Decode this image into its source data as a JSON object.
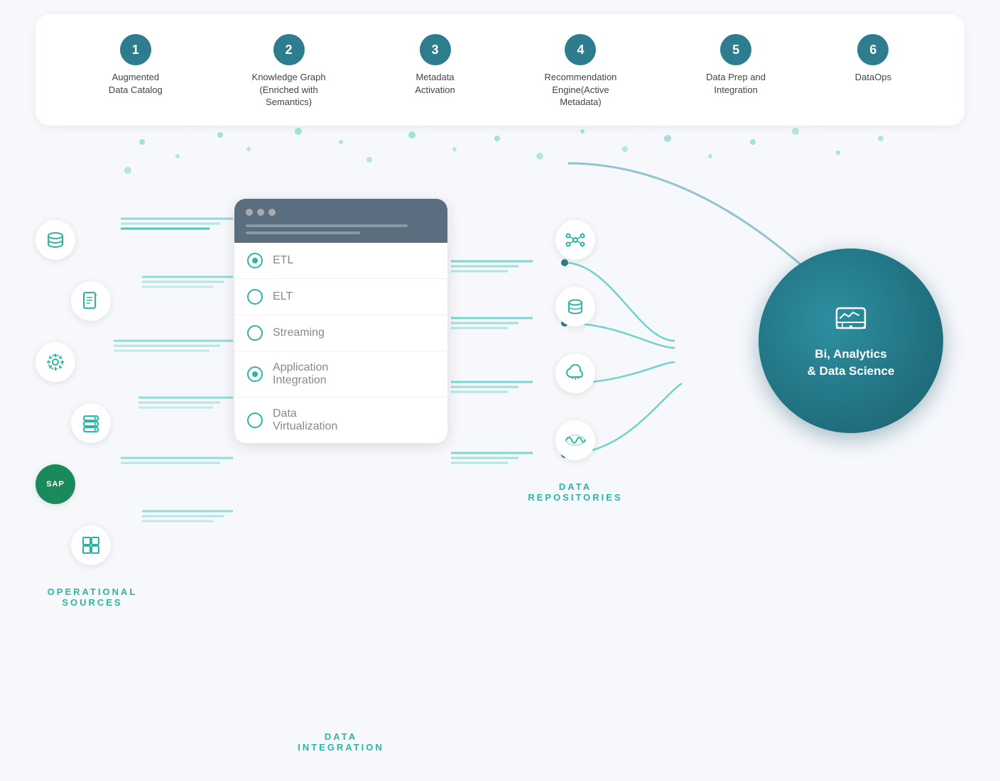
{
  "steps": [
    {
      "num": "1",
      "label": "Augmented\nData Catalog"
    },
    {
      "num": "2",
      "label": "Knowledge Graph\n(Enriched with\nSemantics)"
    },
    {
      "num": "3",
      "label": "Metadata\nActivation"
    },
    {
      "num": "4",
      "label": "Recommendation\nEngine(Active\nMetadata)"
    },
    {
      "num": "5",
      "label": "Data Prep and\nIntegration"
    },
    {
      "num": "6",
      "label": "DataOps"
    }
  ],
  "integration_items": [
    {
      "id": "etl",
      "label": "ETL",
      "has_inner": true
    },
    {
      "id": "elt",
      "label": "ELT",
      "has_inner": false
    },
    {
      "id": "streaming",
      "label": "Streaming",
      "has_inner": false
    },
    {
      "id": "app_integration",
      "label": "Application\nIntegration",
      "has_inner": true
    },
    {
      "id": "data_virt",
      "label": "Data\nVirtualization",
      "has_inner": false
    }
  ],
  "section_labels": {
    "operational": "OPERATIONAL\nSOURCES",
    "data_integration": "DATA\nINTEGRATION",
    "data_repositories": "DATA\nREPOSITORIES"
  },
  "bi_title": "Bi, Analytics\n& Data Science",
  "accent_color": "#2db5a3",
  "dark_teal": "#1e6e7e"
}
